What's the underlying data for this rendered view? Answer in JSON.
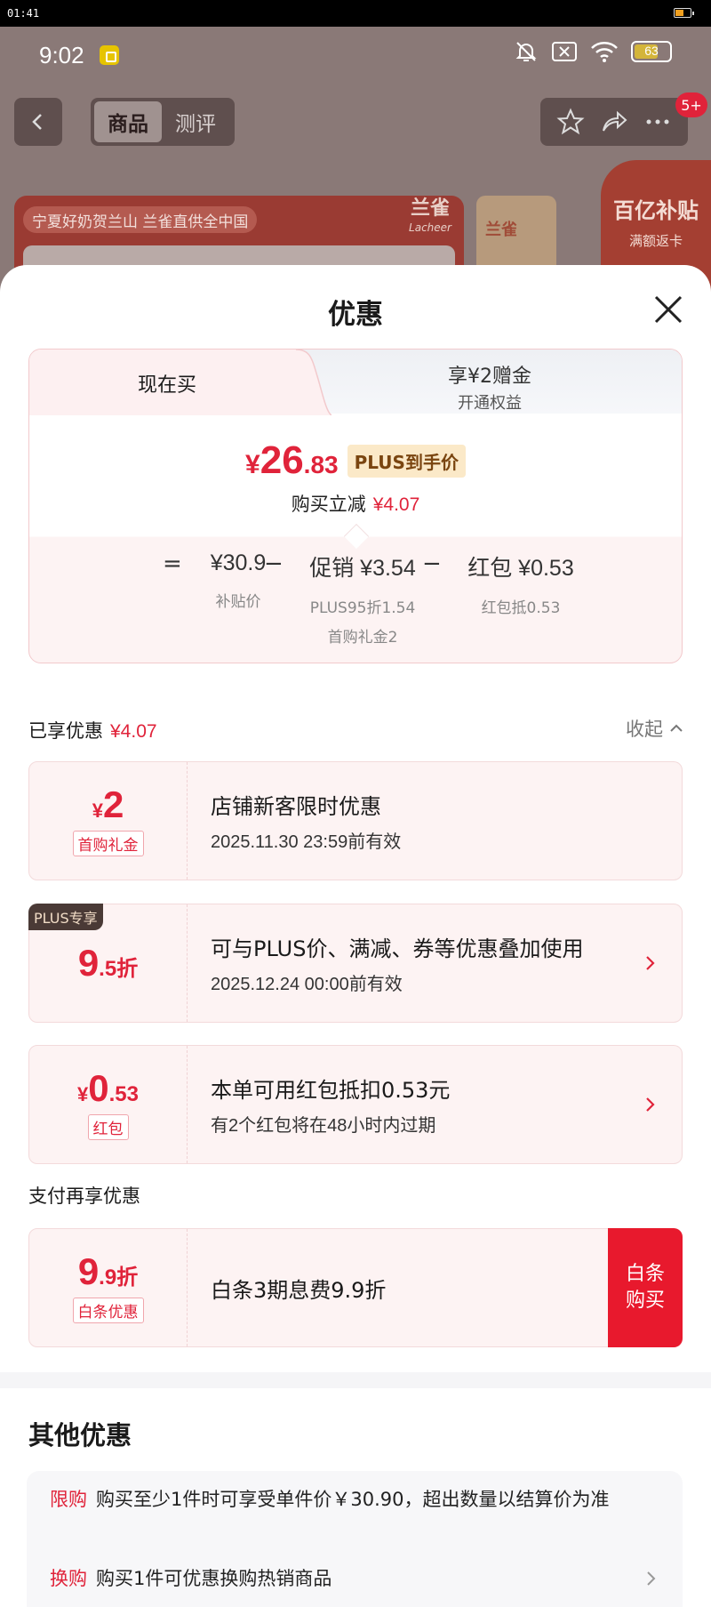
{
  "os": {
    "time": "01:41"
  },
  "phone": {
    "time": "9:02",
    "battery": "63",
    "nav": {
      "tabs": [
        "商品",
        "测评"
      ],
      "badge": "5+"
    },
    "banner": {
      "slogan": "宁夏好奶贺兰山 兰雀直供全中国",
      "brand": "兰雀",
      "brand_en": "Lacheer",
      "side_brand": "兰雀",
      "promo_title": "百亿补贴",
      "promo_sub": "满额返卡"
    }
  },
  "sheet": {
    "title": "优惠",
    "price_tabs": {
      "active": "现在买",
      "other_main": "享¥2赠金",
      "other_sub": "开通权益"
    },
    "price": {
      "currency": "¥",
      "integer": "26",
      "decimal": ".83",
      "tag": "PLUS到手价",
      "saving_label": "购买立减",
      "saving_value": "¥4.07"
    },
    "breakdown": {
      "equals": "=",
      "minus": "−",
      "base_value": "¥30.9",
      "base_label": "补贴价",
      "promo_value": "促销 ¥3.54",
      "promo_sub1": "PLUS95折1.54",
      "promo_sub2": "首购礼金2",
      "redpack_value": "红包 ¥0.53",
      "redpack_sub": "红包抵0.53"
    },
    "enjoyed": {
      "label": "已享优惠",
      "value": "¥4.07",
      "collapse": "收起"
    },
    "coupons": [
      {
        "sym": "¥",
        "big": "2",
        "tag": "首购礼金",
        "title": "店铺新客限时优惠",
        "sub": "2025.11.30 23:59前有效"
      },
      {
        "plus_label": "PLUS专享",
        "big": "9",
        "small": ".5",
        "unit": "折",
        "title": "可与PLUS价、满减、券等优惠叠加使用",
        "sub": "2025.12.24 00:00前有效"
      },
      {
        "sym": "¥",
        "big": "0",
        "small": ".53",
        "tag": "红包",
        "title": "本单可用红包抵扣0.53元",
        "sub": "有2个红包将在48小时内过期"
      }
    ],
    "pay": {
      "heading": "支付再享优惠",
      "big": "9",
      "small": ".9",
      "unit": "折",
      "tag": "白条优惠",
      "title": "白条3期息费9.9折",
      "button_line1": "白条",
      "button_line2": "购买"
    },
    "other": {
      "title": "其他优惠",
      "rows": [
        {
          "tag": "限购",
          "text": "购买至少1件时可享受单件价￥30.90，超出数量以结算价为准"
        },
        {
          "tag": "换购",
          "text": "购买1件可优惠换购热销商品"
        }
      ]
    }
  },
  "colors": {
    "accent": "#e0233a",
    "card_bg": "#fdf3f3",
    "plus_dark": "#4a3a36"
  }
}
